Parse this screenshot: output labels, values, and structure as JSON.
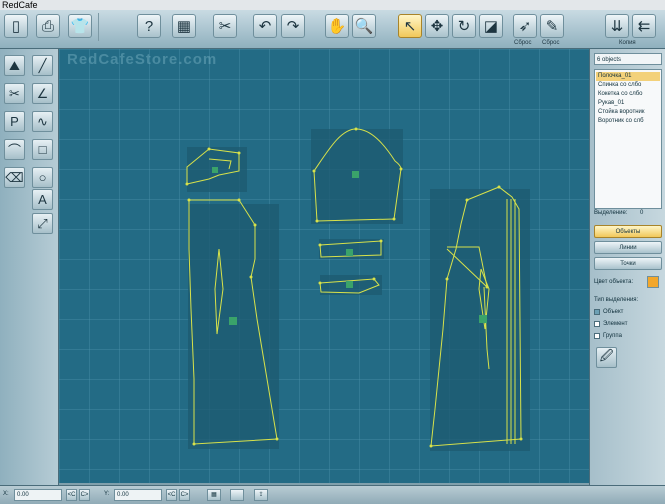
{
  "window": {
    "title": "RedCafe"
  },
  "toolbar": {
    "label_reset_1": "Сброс",
    "label_reset_2": "Сброс",
    "label_copy": "Копия"
  },
  "canvas": {
    "watermark": "RedCafeStore.com"
  },
  "panel": {
    "count": "6 objects",
    "objects": [
      "Полочка_01",
      "Спинка со слбо",
      "Кокетка со слбо",
      "Рукав_01",
      "Стойка воротник",
      "Воротник со слб"
    ],
    "selected_label": "Выделение:",
    "selected_value": "0",
    "btn_objects": "Объекты",
    "btn_lines": "Линии",
    "btn_points": "Точки",
    "color_label": "Цвет объекта:",
    "object_color": "#f3a72b",
    "sel_type_label": "Тип выделения:",
    "radio": [
      "Объект",
      "Элемент",
      "Группа"
    ]
  },
  "status": {
    "x_label": "X:",
    "x_value": "0.00",
    "y_label": "Y:",
    "y_value": "0.00",
    "btn_lt": "<C",
    "btn_gt": "C>"
  },
  "colors": {
    "canvas": "#236b85",
    "pattern": "#d8e24a",
    "accent": "#f1c85a"
  }
}
